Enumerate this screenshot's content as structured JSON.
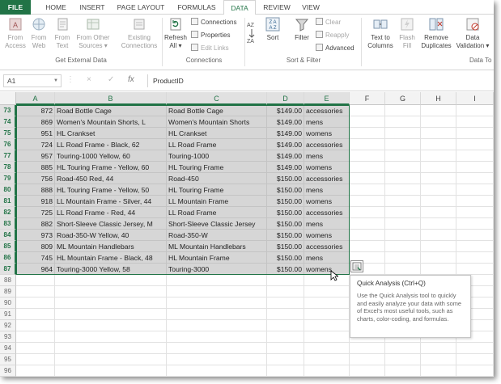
{
  "tabs": [
    "FILE",
    "HOME",
    "INSERT",
    "PAGE LAYOUT",
    "FORMULAS",
    "DATA",
    "REVIEW",
    "VIEW"
  ],
  "active_tab": "DATA",
  "ribbon": {
    "from_access": [
      "From",
      "Access"
    ],
    "from_web": [
      "From",
      "Web"
    ],
    "from_text": [
      "From",
      "Text"
    ],
    "from_other": [
      "From Other",
      "Sources ▾"
    ],
    "existing": [
      "Existing",
      "Connections"
    ],
    "refresh": [
      "Refresh",
      "All ▾"
    ],
    "connections": "Connections",
    "properties": "Properties",
    "edit_links": "Edit Links",
    "sort": "Sort",
    "filter": "Filter",
    "clear": "Clear",
    "reapply": "Reapply",
    "advanced": "Advanced",
    "text_to_columns": [
      "Text to",
      "Columns"
    ],
    "flash_fill": [
      "Flash",
      "Fill"
    ],
    "remove_duplicates": [
      "Remove",
      "Duplicates"
    ],
    "data_validation": [
      "Data",
      "Validation ▾"
    ],
    "group_external": "Get External Data",
    "group_connections": "Connections",
    "group_sort": "Sort & Filter",
    "group_tools": "Data To"
  },
  "formula_bar": {
    "name_box": "A1",
    "value": "ProductID",
    "fx": "fx",
    "cancel": "×",
    "enter": "✓"
  },
  "columns": [
    "A",
    "B",
    "C",
    "D",
    "E",
    "F",
    "G",
    "H",
    "I"
  ],
  "rows": [
    {
      "n": "73",
      "a": "872",
      "b": "Road Bottle Cage",
      "c": "Road Bottle Cage",
      "d": "$149.00",
      "e": "accessories"
    },
    {
      "n": "74",
      "a": "869",
      "b": "Women's Mountain Shorts, L",
      "c": "Women's Mountain Shorts",
      "d": "$149.00",
      "e": "mens"
    },
    {
      "n": "75",
      "a": "951",
      "b": "HL Crankset",
      "c": "HL Crankset",
      "d": "$149.00",
      "e": "womens"
    },
    {
      "n": "76",
      "a": "724",
      "b": "LL Road Frame - Black, 62",
      "c": "LL Road Frame",
      "d": "$149.00",
      "e": "accessories"
    },
    {
      "n": "77",
      "a": "957",
      "b": "Touring-1000 Yellow, 60",
      "c": "Touring-1000",
      "d": "$149.00",
      "e": "mens"
    },
    {
      "n": "78",
      "a": "885",
      "b": "HL Touring Frame - Yellow, 60",
      "c": "HL Touring Frame",
      "d": "$149.00",
      "e": "womens"
    },
    {
      "n": "79",
      "a": "756",
      "b": "Road-450 Red, 44",
      "c": "Road-450",
      "d": "$150.00",
      "e": "accessories"
    },
    {
      "n": "80",
      "a": "888",
      "b": "HL Touring Frame - Yellow, 50",
      "c": "HL Touring Frame",
      "d": "$150.00",
      "e": "mens"
    },
    {
      "n": "81",
      "a": "918",
      "b": "LL Mountain Frame - Silver, 44",
      "c": "LL Mountain Frame",
      "d": "$150.00",
      "e": "womens"
    },
    {
      "n": "82",
      "a": "725",
      "b": "LL Road Frame - Red, 44",
      "c": "LL Road Frame",
      "d": "$150.00",
      "e": "accessories"
    },
    {
      "n": "83",
      "a": "882",
      "b": "Short-Sleeve Classic Jersey, M",
      "c": "Short-Sleeve Classic Jersey",
      "d": "$150.00",
      "e": "mens"
    },
    {
      "n": "84",
      "a": "973",
      "b": "Road-350-W Yellow, 40",
      "c": "Road-350-W",
      "d": "$150.00",
      "e": "womens"
    },
    {
      "n": "85",
      "a": "809",
      "b": "ML Mountain Handlebars",
      "c": "ML Mountain Handlebars",
      "d": "$150.00",
      "e": "accessories"
    },
    {
      "n": "86",
      "a": "745",
      "b": "HL Mountain Frame - Black, 48",
      "c": "HL Mountain Frame",
      "d": "$150.00",
      "e": "mens"
    },
    {
      "n": "87",
      "a": "964",
      "b": "Touring-3000 Yellow, 58",
      "c": "Touring-3000",
      "d": "$150.00",
      "e": "womens"
    }
  ],
  "empty_rows": [
    "88",
    "89",
    "90",
    "91",
    "92",
    "93",
    "94",
    "95",
    "96"
  ],
  "quick_analysis": {
    "title": "Quick Analysis (Ctrl+Q)",
    "desc": "Use the Quick Analysis tool to quickly and easily analyze your data with some of Excel's most useful tools, such as charts, color-coding, and formulas."
  },
  "colors": {
    "excel_green": "#217346",
    "selection_fill": "#d6d6d6"
  }
}
